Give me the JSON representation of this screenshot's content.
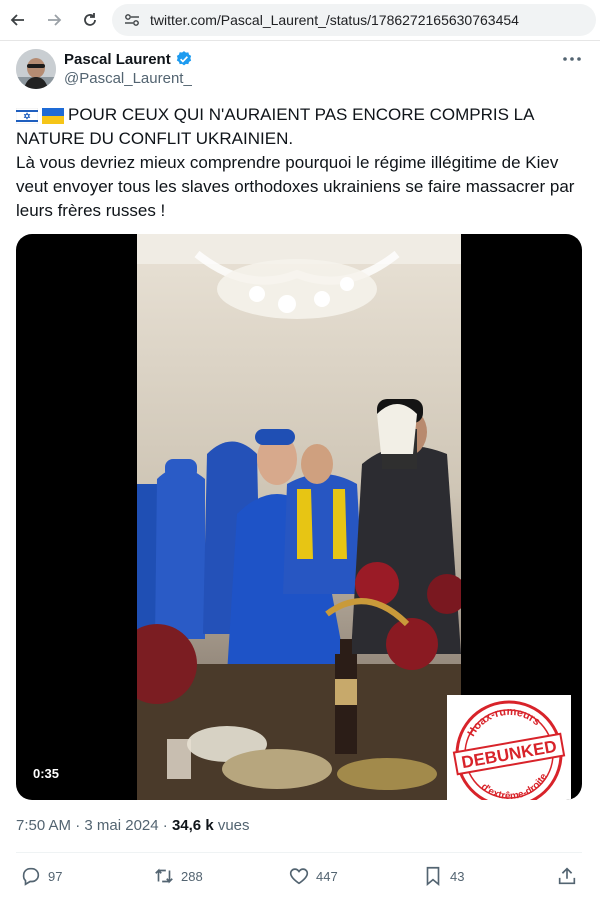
{
  "browser": {
    "url": "twitter.com/Pascal_Laurent_/status/1786272165630763454"
  },
  "author": {
    "name": "Pascal Laurent",
    "handle": "@Pascal_Laurent_",
    "verified_color": "#1d9bf0"
  },
  "tweet": {
    "line1": "POUR CEUX QUI N'AURAIENT PAS ENCORE COMPRIS LA NATURE DU CONFLIT UKRAINIEN.",
    "line2": "Là vous devriez mieux comprendre pourquoi le régime illégitime de Kiev veut envoyer tous les slaves orthodoxes ukrainiens se faire massacrer par leurs frères russes !",
    "flags": [
      "israel-flag",
      "ukraine-flag"
    ]
  },
  "media": {
    "duration": "0:35",
    "stamp": {
      "top": "Hoax-rumeurs",
      "middle": "DEBUNKED",
      "bottom": "d'extrême-droite",
      "color": "#d8232a"
    }
  },
  "meta": {
    "time": "7:50 AM",
    "sep": "·",
    "date": "3 mai 2024",
    "views": "34,6 k",
    "views_label": "vues"
  },
  "actions": {
    "replies": "97",
    "reposts": "288",
    "likes": "447",
    "bookmarks": "43"
  }
}
